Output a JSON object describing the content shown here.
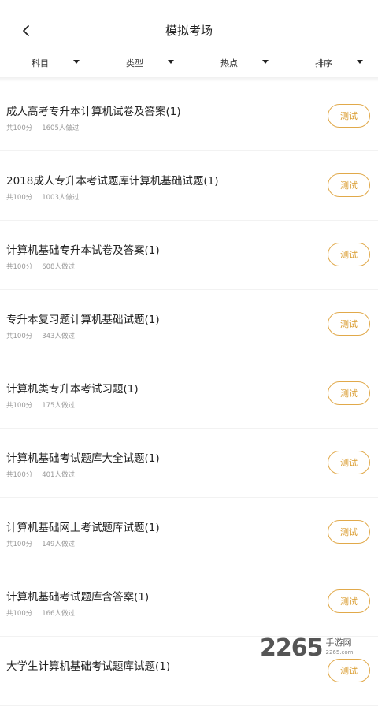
{
  "header": {
    "title": "模拟考场"
  },
  "filters": [
    {
      "label": "科目"
    },
    {
      "label": "类型"
    },
    {
      "label": "热点"
    },
    {
      "label": "排序"
    }
  ],
  "items": [
    {
      "title": "成人高考专升本计算机试卷及答案(1)",
      "score": "共100分",
      "count": "1605人做过",
      "button": "测试"
    },
    {
      "title": "2018成人专升本考试题库计算机基础试题(1)",
      "score": "共100分",
      "count": "1003人做过",
      "button": "测试"
    },
    {
      "title": "计算机基础专升本试卷及答案(1)",
      "score": "共100分",
      "count": "608人做过",
      "button": "测试"
    },
    {
      "title": "专升本复习题计算机基础试题(1)",
      "score": "共100分",
      "count": "343人做过",
      "button": "测试"
    },
    {
      "title": "计算机类专升本考试习题(1)",
      "score": "共100分",
      "count": "175人做过",
      "button": "测试"
    },
    {
      "title": "计算机基础考试题库大全试题(1)",
      "score": "共100分",
      "count": "401人做过",
      "button": "测试"
    },
    {
      "title": "计算机基础网上考试题库试题(1)",
      "score": "共100分",
      "count": "149人做过",
      "button": "测试"
    },
    {
      "title": "计算机基础考试题库含答案(1)",
      "score": "共100分",
      "count": "166人做过",
      "button": "测试"
    },
    {
      "title": "大学生计算机基础考试题库试题(1)",
      "score": "",
      "count": "",
      "button": "测试"
    }
  ],
  "watermark": {
    "number": "2265",
    "site": "手游网",
    "domain": "2265.com"
  }
}
